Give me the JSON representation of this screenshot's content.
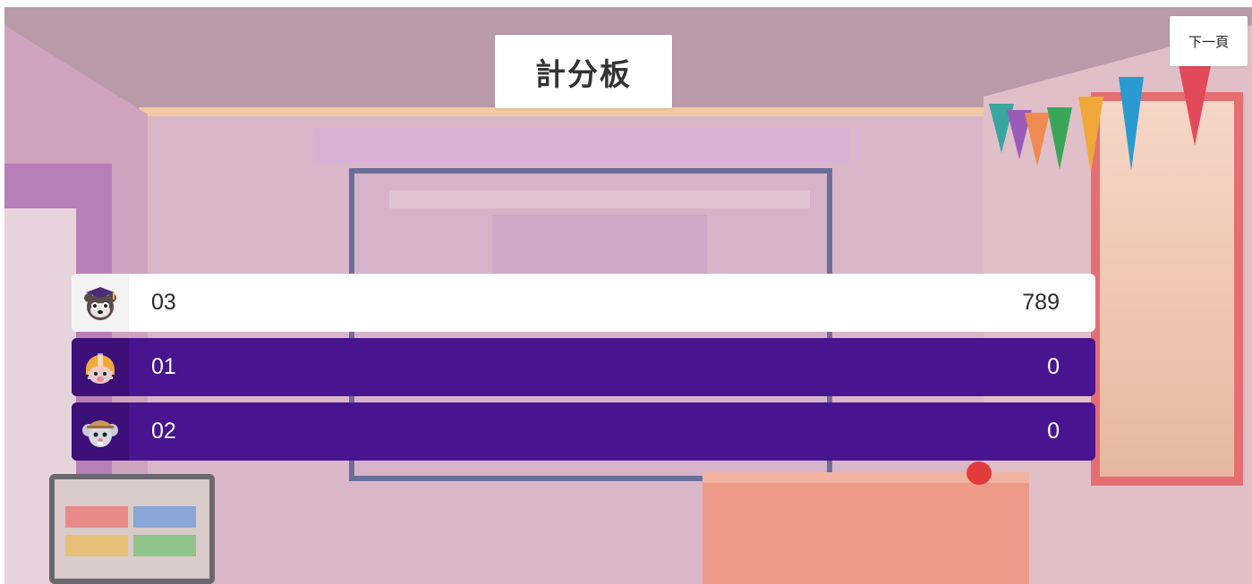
{
  "title": "計分板",
  "next_button": "下一頁",
  "leaderboard": [
    {
      "name": "03",
      "score": "789",
      "avatar": "raccoon-graduate-icon"
    },
    {
      "name": "01",
      "score": "0",
      "avatar": "football-helmet-pig-icon"
    },
    {
      "name": "02",
      "score": "0",
      "avatar": "mouse-explorer-icon"
    }
  ],
  "colors": {
    "highlight_row": "#ffffff",
    "row": "#481490",
    "avatar_bg": "#3c0f79"
  }
}
